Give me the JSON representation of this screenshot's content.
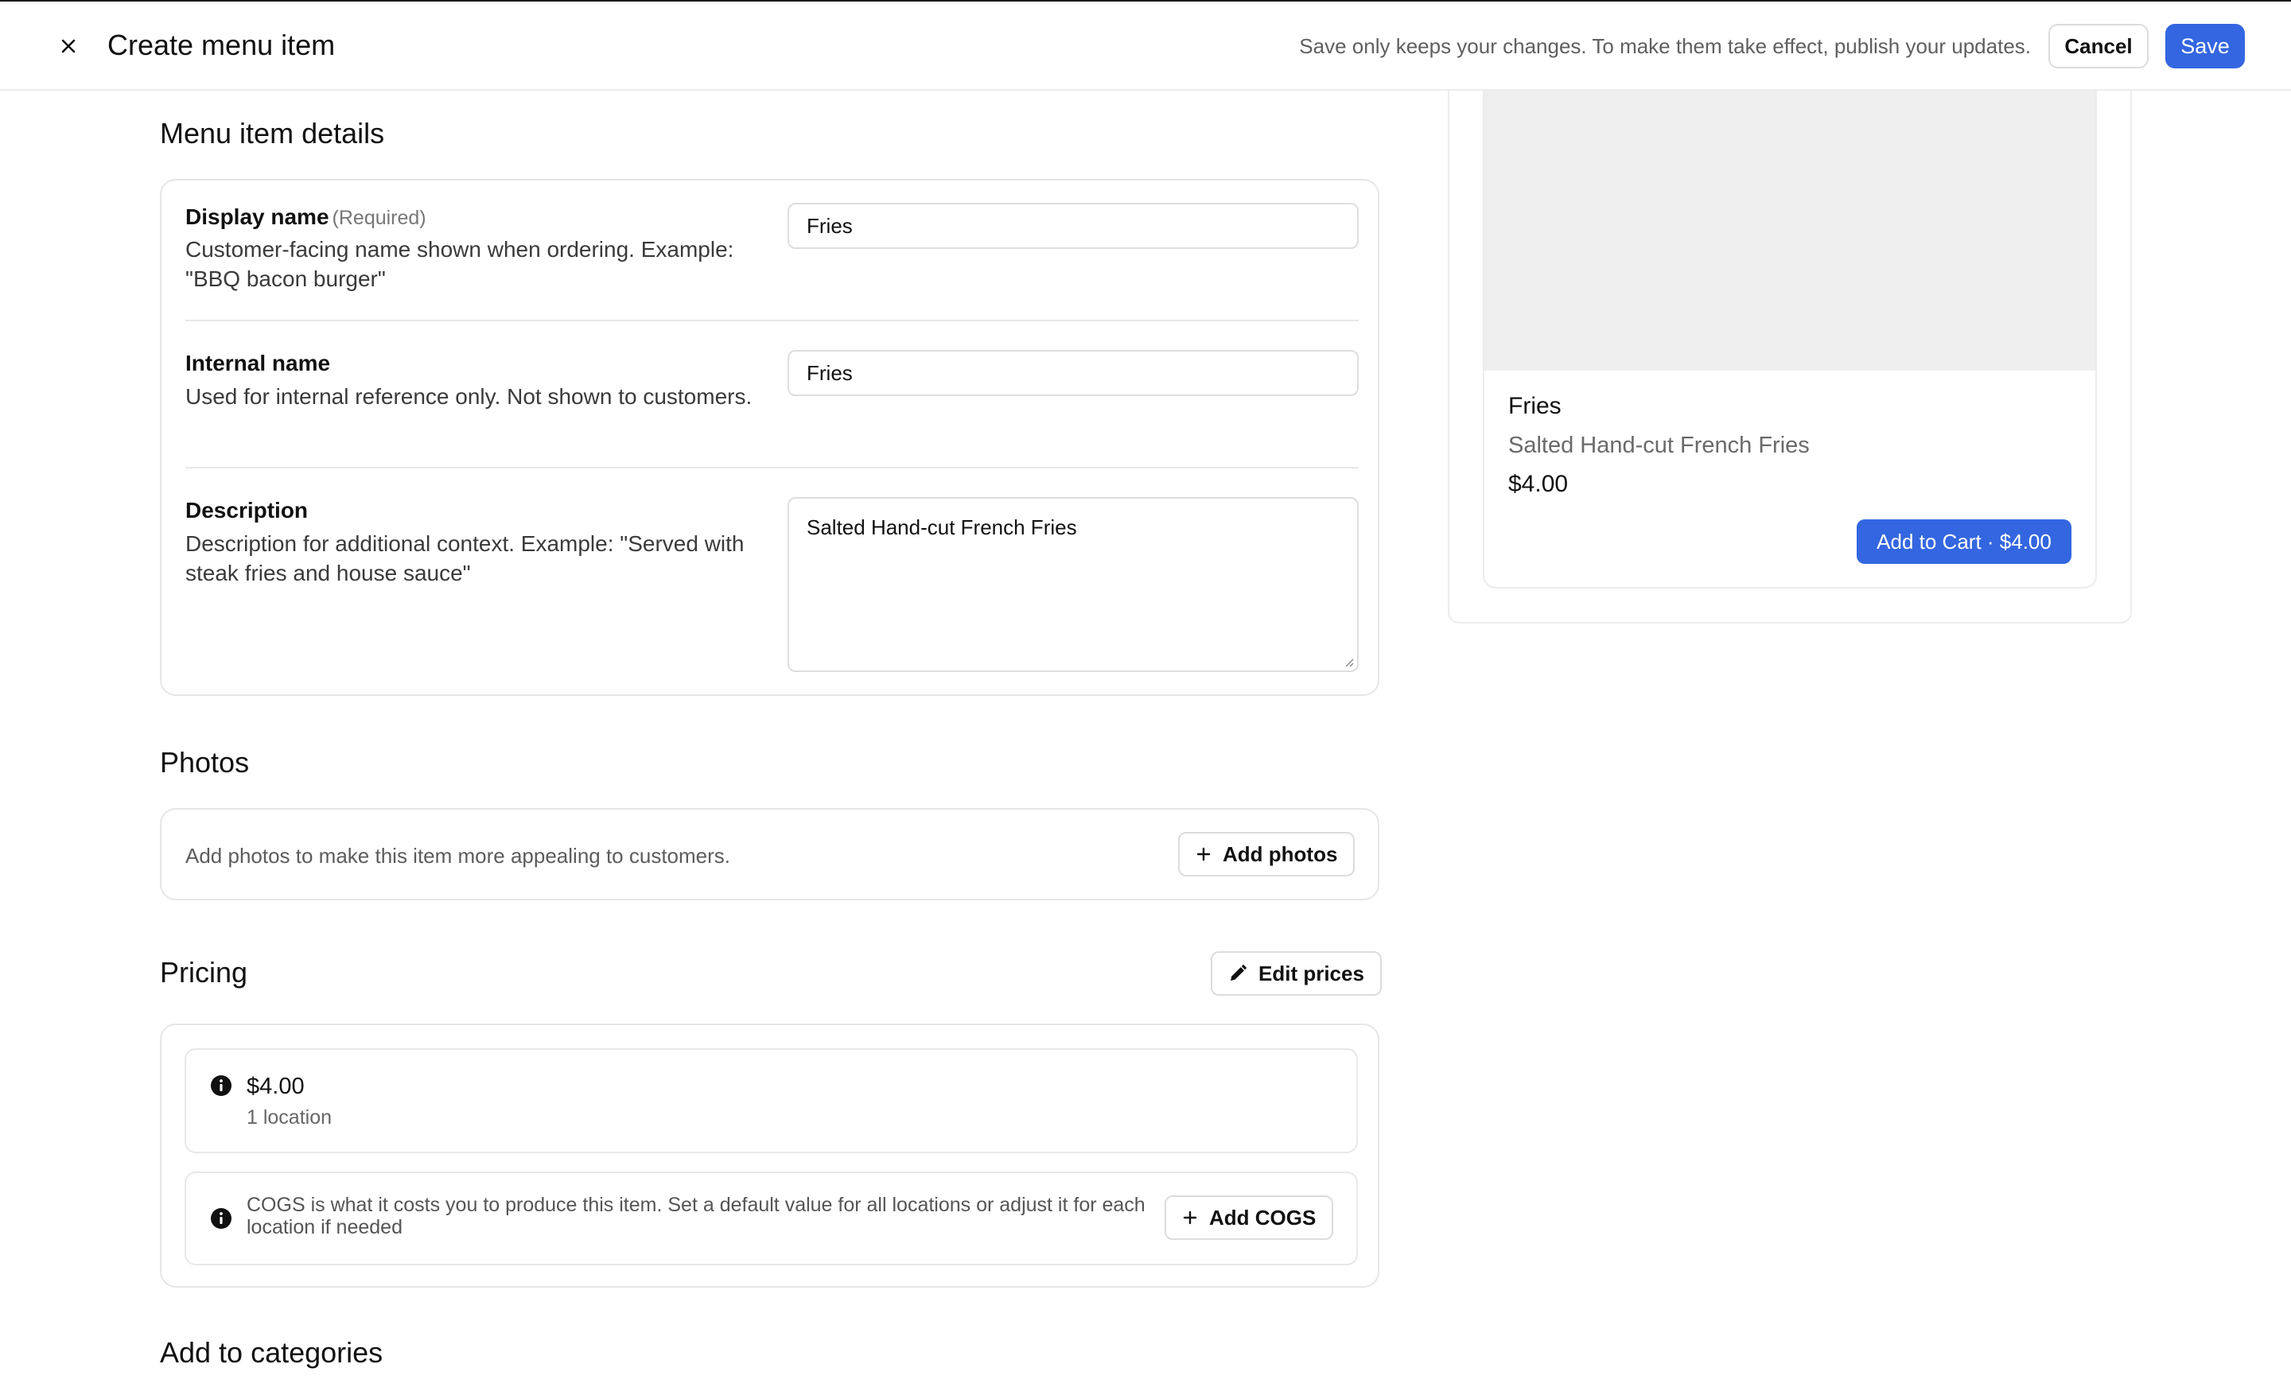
{
  "header": {
    "title": "Create menu item",
    "note": "Save only keeps your changes. To make them take effect, publish your updates.",
    "cancel_label": "Cancel",
    "save_label": "Save"
  },
  "details": {
    "title": "Menu item details",
    "display_name": {
      "label": "Display name",
      "required": "(Required)",
      "help": "Customer-facing name shown when ordering. Example: \"BBQ bacon burger\"",
      "value": "Fries"
    },
    "internal_name": {
      "label": "Internal name",
      "help": "Used for internal reference only. Not shown to customers.",
      "value": "Fries"
    },
    "description": {
      "label": "Description",
      "help": "Description for additional context. Example: \"Served with steak fries and house sauce\"",
      "value": "Salted Hand-cut French Fries"
    }
  },
  "photos": {
    "title": "Photos",
    "text": "Add photos to make this item more appealing to customers.",
    "add_label": "Add photos"
  },
  "pricing": {
    "title": "Pricing",
    "edit_label": "Edit prices",
    "price": "$4.00",
    "locations": "1 location",
    "cogs_text": "COGS is what it costs you to produce this item. Set a default value for all locations or adjust it for each location if needed",
    "add_cogs_label": "Add COGS"
  },
  "categories": {
    "title": "Add to categories"
  },
  "preview": {
    "name": "Fries",
    "description": "Salted Hand-cut French Fries",
    "price": "$4.00",
    "cart_label": "Add to Cart · $4.00"
  },
  "icons": {
    "close": "close-icon",
    "plus": "plus-icon",
    "pencil": "pencil-icon",
    "info": "info-icon"
  },
  "colors": {
    "primary": "#3366e0",
    "border": "#e6e6e6",
    "image_placeholder": "#efefef"
  }
}
